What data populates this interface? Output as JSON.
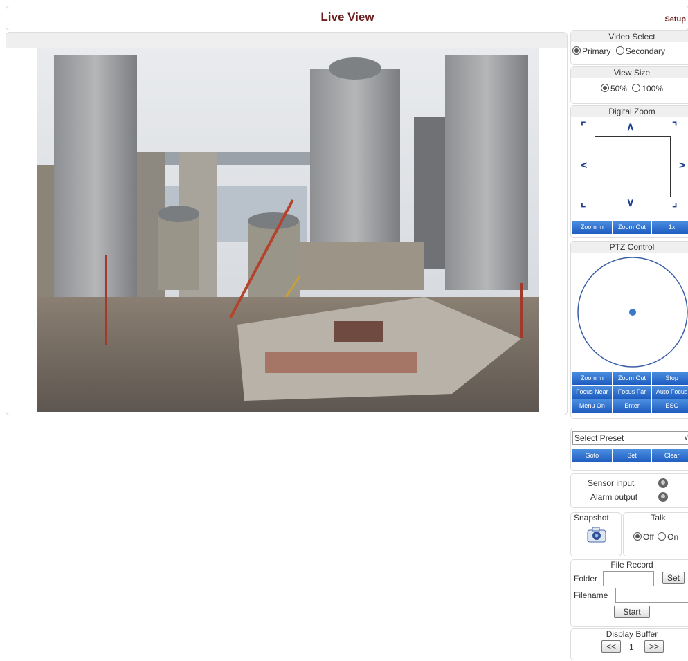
{
  "header": {
    "title": "Live View",
    "setup_label": "Setup"
  },
  "video_select": {
    "title": "Video Select",
    "options": [
      "Primary",
      "Secondary"
    ],
    "selected": "Primary"
  },
  "view_size": {
    "title": "View Size",
    "options": [
      "50%",
      "100%"
    ],
    "selected": "50%"
  },
  "digital_zoom": {
    "title": "Digital Zoom",
    "buttons": [
      "Zoom In",
      "Zoom Out",
      "1x"
    ]
  },
  "ptz": {
    "title": "PTZ Control",
    "buttons": [
      "Zoom In",
      "Zoom Out",
      "Stop",
      "Focus Near",
      "Focus Far",
      "Auto Focus",
      "Menu On",
      "Enter",
      "ESC"
    ]
  },
  "preset": {
    "select_value": "Select Preset",
    "buttons": [
      "Goto",
      "Set",
      "Clear"
    ]
  },
  "io": {
    "sensor_label": "Sensor input",
    "alarm_label": "Alarm output"
  },
  "snapshot": {
    "label": "Snapshot"
  },
  "talk": {
    "label": "Talk",
    "options": [
      "Off",
      "On"
    ],
    "selected": "Off"
  },
  "file_record": {
    "title": "File Record",
    "folder_label": "Folder",
    "folder_value": "",
    "set_label": "Set",
    "filename_label": "Filename",
    "filename_value": "",
    "start_label": "Start"
  },
  "display_buffer": {
    "title": "Display Buffer",
    "prev_label": "<<",
    "value": "1",
    "next_label": ">>"
  }
}
